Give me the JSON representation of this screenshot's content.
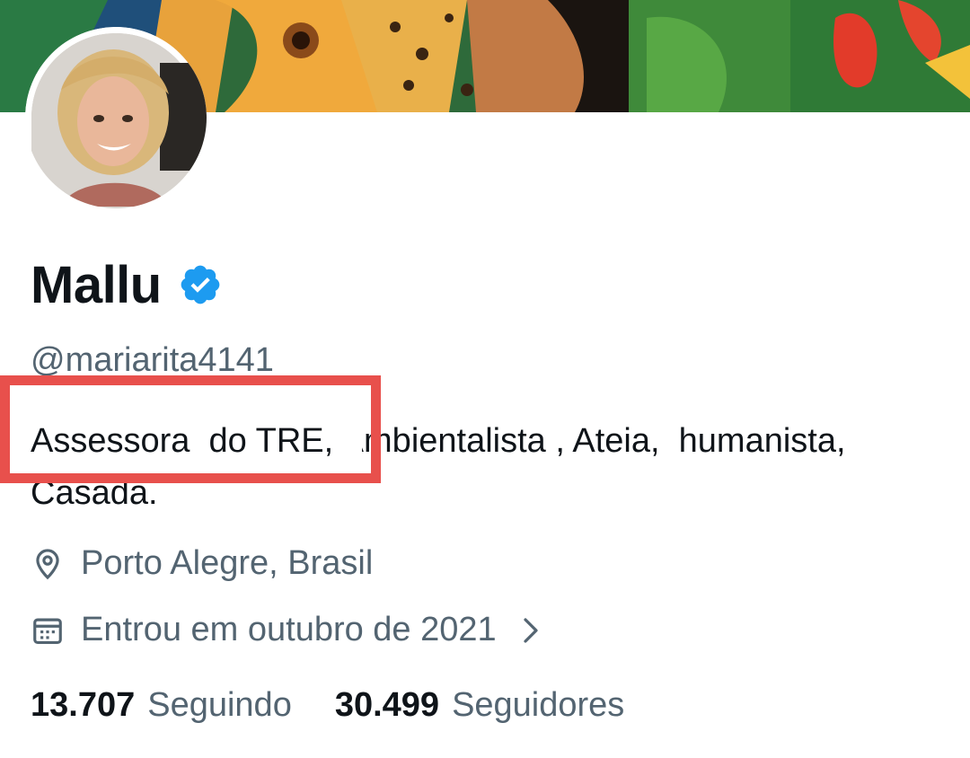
{
  "profile": {
    "display_name": "Mallu",
    "handle": "@mariarita4141",
    "verified_icon": "verified-badge-icon",
    "bio_first": "Assessora  do TRE,",
    "bio_rest": " Ambientalista , Ateia,  humanista, Casada.",
    "location": "Porto Alegre, Brasil",
    "joined": "Entrou em outubro de 2021"
  },
  "stats": {
    "following_count": "13.707",
    "following_label": "Seguindo",
    "followers_count": "30.499",
    "followers_label": "Seguidores"
  },
  "icons": {
    "location": "location-pin-icon",
    "calendar": "calendar-icon",
    "chevron": "chevron-right-icon"
  },
  "colors": {
    "verified_blue": "#1d9bf0",
    "secondary_text": "#536471",
    "primary_text": "#0f1419",
    "highlight_red": "#e8504c"
  }
}
